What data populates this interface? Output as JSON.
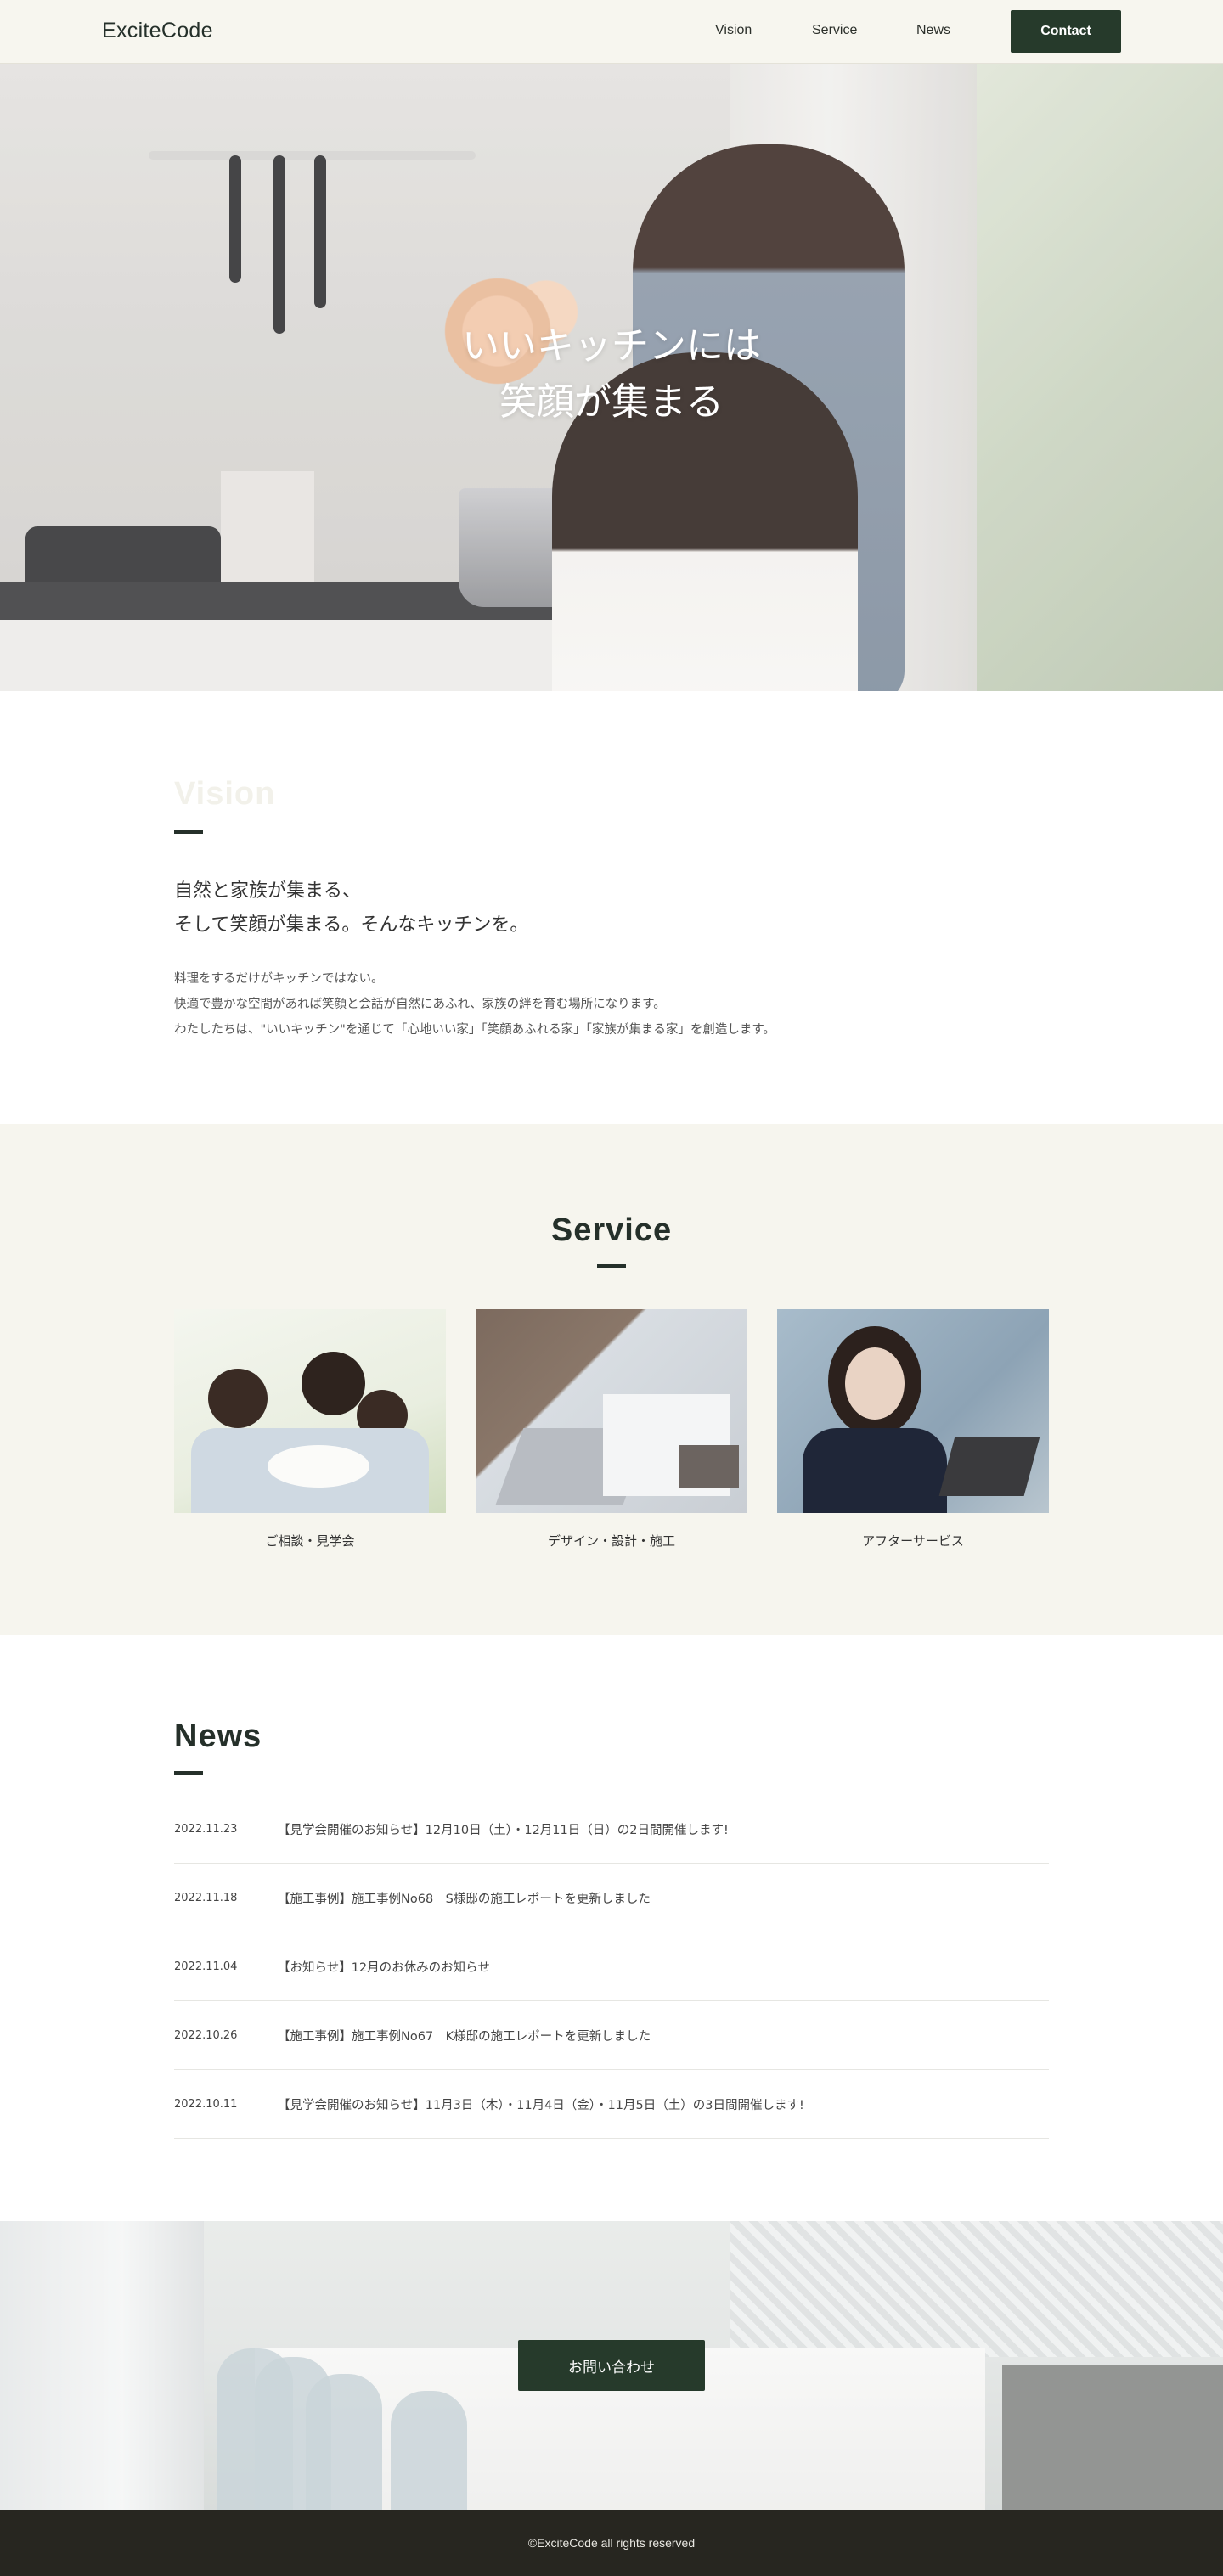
{
  "header": {
    "logo": "ExciteCode",
    "nav": {
      "vision": "Vision",
      "service": "Service",
      "news": "News"
    },
    "contact_label": "Contact"
  },
  "hero": {
    "title_line1": "いいキッチンには",
    "title_line2": "笑顔が集まる"
  },
  "vision": {
    "heading": "Vision",
    "lead_line1": "自然と家族が集まる、",
    "lead_line2": "そして笑顔が集まる。そんなキッチンを。",
    "body_line1": "料理をするだけがキッチンではない。",
    "body_line2": "快適で豊かな空間があれば笑顔と会話が自然にあふれ、家族の絆を育む場所になります。",
    "body_line3": "わたしたちは、\"いいキッチン\"を通じて「心地いい家」「笑顔あふれる家」「家族が集まる家」を創造します。"
  },
  "service": {
    "heading": "Service",
    "cards": [
      {
        "label": "ご相談・見学会"
      },
      {
        "label": "デザイン・設計・施工"
      },
      {
        "label": "アフターサービス"
      }
    ]
  },
  "news": {
    "heading": "News",
    "items": [
      {
        "date": "2022.11.23",
        "title": "【見学会開催のお知らせ】12月10日（土）・12月11日（日）の2日間開催します!"
      },
      {
        "date": "2022.11.18",
        "title": "【施工事例】施工事例No68　S様邸の施工レポートを更新しました"
      },
      {
        "date": "2022.11.04",
        "title": "【お知らせ】12月のお休みのお知らせ"
      },
      {
        "date": "2022.10.26",
        "title": "【施工事例】施工事例No67　K様邸の施工レポートを更新しました"
      },
      {
        "date": "2022.10.11",
        "title": "【見学会開催のお知らせ】11月3日（木）・11月4日（金）・11月5日（土）の3日間開催します!"
      }
    ]
  },
  "cta": {
    "button_label": "お問い合わせ"
  },
  "footer": {
    "copyright": "©ExciteCode all rights reserved"
  },
  "colors": {
    "accent": "#263a2b",
    "cream": "#f6f5ee",
    "footer": "#272620"
  }
}
